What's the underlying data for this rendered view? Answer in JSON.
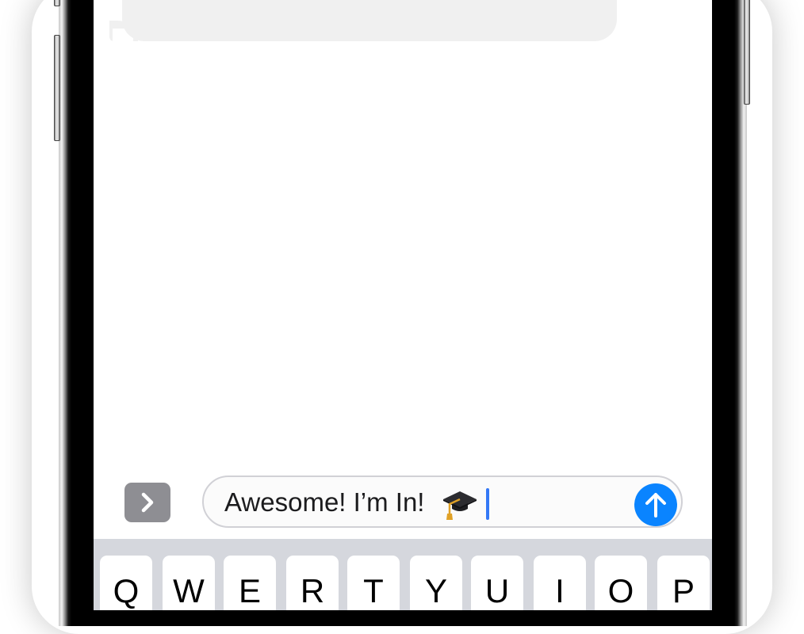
{
  "compose": {
    "text": "Awesome! I’m In!"
  },
  "icons": {
    "apps_toggle": "chevron-right-icon",
    "send": "arrow-up-icon",
    "emoji": "graduation-cap-emoji"
  },
  "colors": {
    "send_button": "#0a84ff",
    "cursor": "#3478f6",
    "apps_button": "#8e8e93",
    "keyboard_bg": "#d5d7dd",
    "incoming_bubble": "#f0f0f0"
  },
  "keyboard": {
    "keys": [
      {
        "label": "Q"
      },
      {
        "label": "W"
      },
      {
        "label": "E"
      },
      {
        "label": "R"
      },
      {
        "label": "T"
      },
      {
        "label": "Y"
      },
      {
        "label": "U"
      },
      {
        "label": "I"
      },
      {
        "label": "O"
      },
      {
        "label": "P"
      }
    ]
  }
}
